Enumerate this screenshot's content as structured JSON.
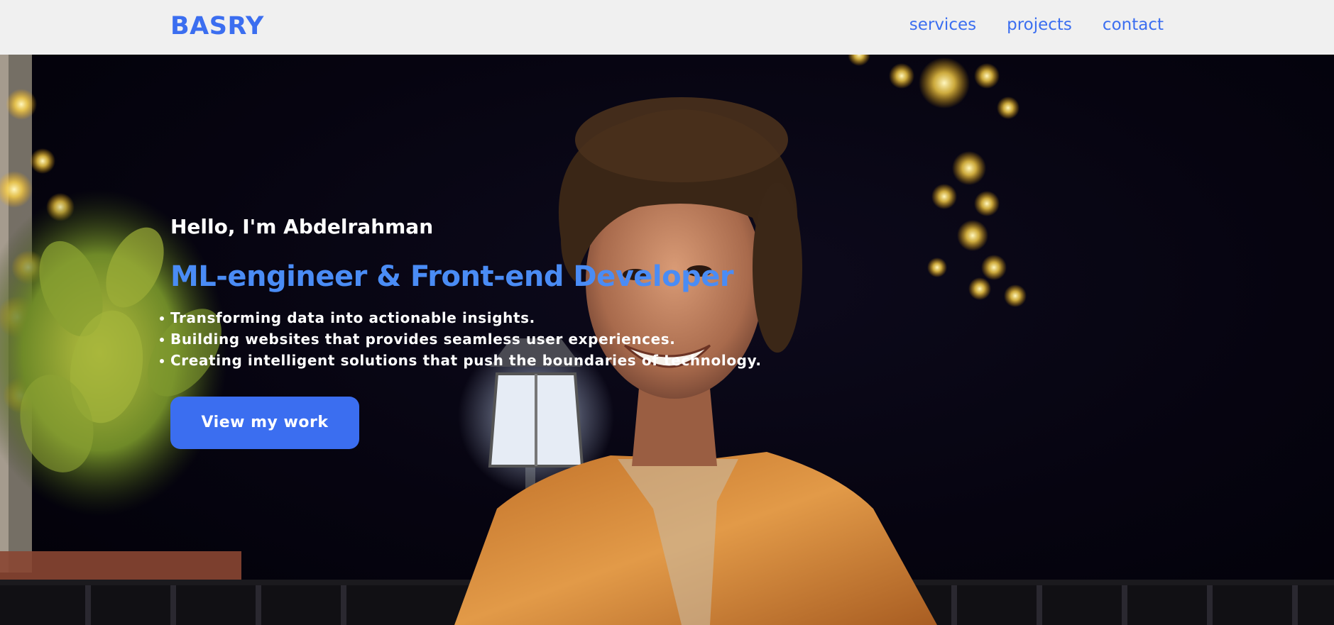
{
  "header": {
    "logo": "BASRY",
    "nav": [
      {
        "label": "services"
      },
      {
        "label": "projects"
      },
      {
        "label": "contact"
      }
    ]
  },
  "hero": {
    "greeting": "Hello, I'm Abdelrahman",
    "role": "ML-engineer & Front-end Developer",
    "bullets": [
      "Transforming data into actionable insights.",
      "Building websites that provides seamless user experiences.",
      "Creating intelligent solutions that push the boundaries of technology."
    ],
    "cta_label": "View my work"
  },
  "colors": {
    "accent": "#3b6ef0",
    "role_text": "#4a8cf5",
    "header_bg": "#f0f0f0"
  }
}
